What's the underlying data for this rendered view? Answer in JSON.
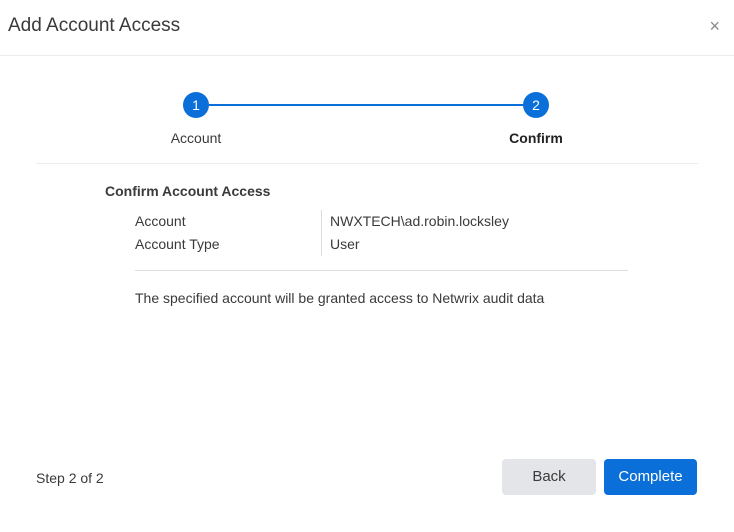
{
  "dialog": {
    "title": "Add Account Access",
    "close_icon": "×"
  },
  "stepper": {
    "steps": [
      {
        "number": "1",
        "label": "Account",
        "state": "completed"
      },
      {
        "number": "2",
        "label": "Confirm",
        "state": "active"
      }
    ],
    "accent_color": "#0a6fd8"
  },
  "confirm": {
    "section_title": "Confirm Account Access",
    "rows": [
      {
        "key": "Account",
        "value": "NWXTECH\\ad.robin.locksley"
      },
      {
        "key": "Account Type",
        "value": "User"
      }
    ],
    "note": "The specified account will be granted access to Netwrix audit data"
  },
  "footer": {
    "step_count": "Step 2 of 2",
    "back_label": "Back",
    "complete_label": "Complete"
  }
}
